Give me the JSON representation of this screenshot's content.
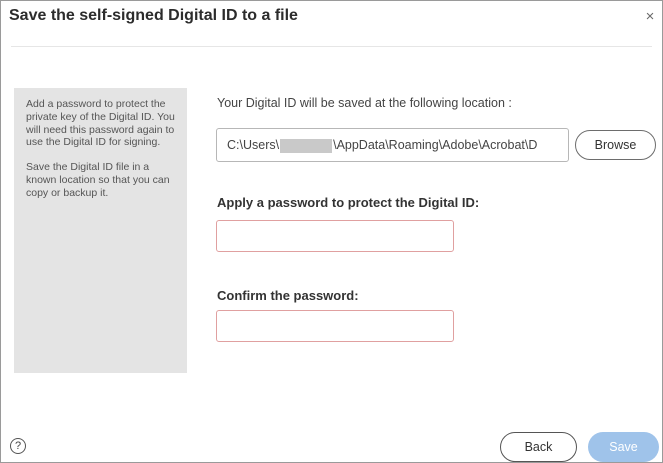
{
  "dialog": {
    "title": "Save the self-signed Digital ID to a file",
    "close_symbol": "×"
  },
  "sidebar": {
    "paragraphs": [
      "Add a password to protect the private key of the Digital ID. You will need this password again to use the Digital ID for signing.",
      "Save the Digital ID file in a known location so that you can copy or backup it."
    ]
  },
  "location": {
    "label": "Your Digital ID will be saved at the following location :",
    "path_prefix": "C:\\Users\\",
    "path_suffix": "\\AppData\\Roaming\\Adobe\\Acrobat\\D",
    "browse_label": "Browse"
  },
  "password": {
    "label": "Apply a password to protect the Digital ID:",
    "value": ""
  },
  "confirm": {
    "label": "Confirm the password:",
    "value": ""
  },
  "footer": {
    "help_symbol": "?",
    "back_label": "Back",
    "save_label": "Save"
  },
  "colors": {
    "sidebar_bg": "#e4e4e4",
    "field_error_border": "#e0a0a0",
    "save_disabled": "#9fc3ea"
  },
  "icons": [
    "close-icon",
    "help-icon"
  ]
}
